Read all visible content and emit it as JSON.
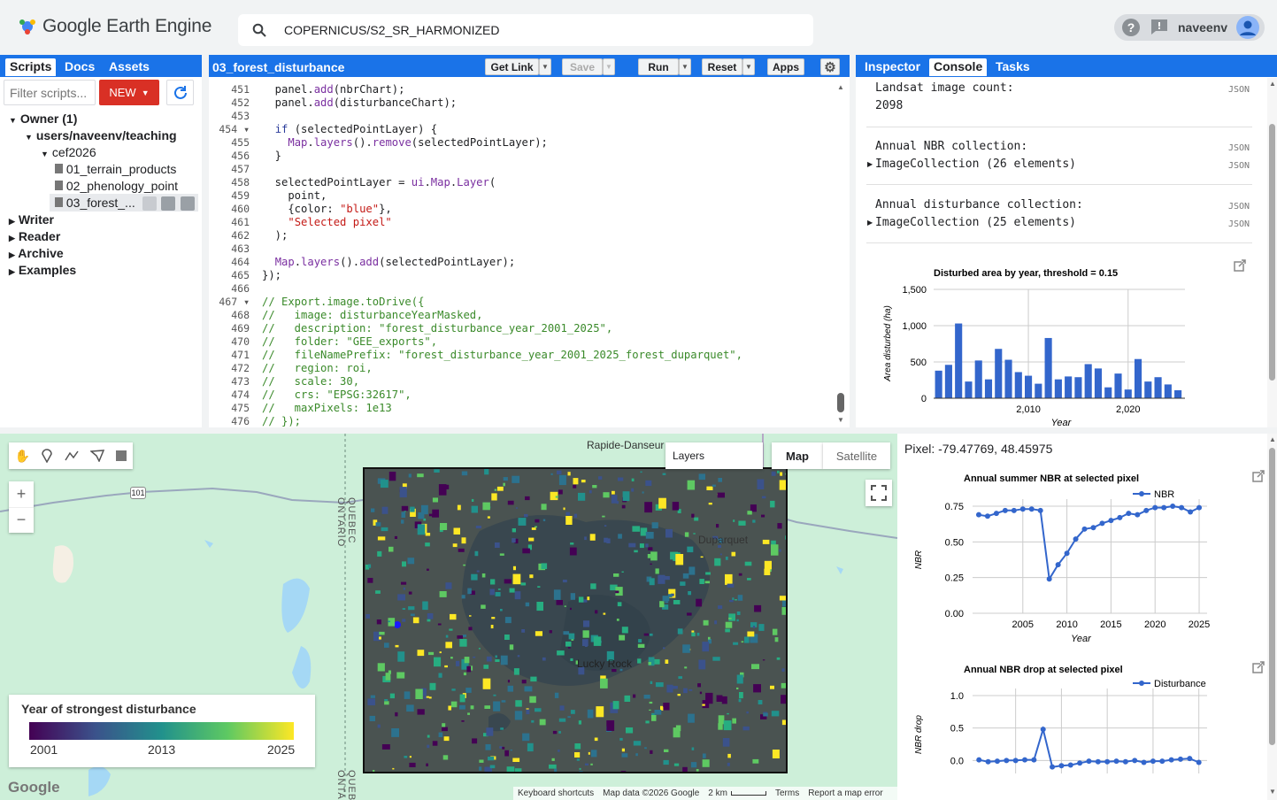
{
  "app": {
    "title": "Google Earth Engine"
  },
  "search": {
    "query": "COPERNICUS/S2_SR_HARMONIZED"
  },
  "user": {
    "name": "naveenv"
  },
  "left_panel": {
    "tabs": [
      "Scripts",
      "Docs",
      "Assets"
    ],
    "filter_placeholder": "Filter scripts...",
    "new_label": "NEW",
    "tree": {
      "owner": "Owner (1)",
      "repo": "users/naveenv/teaching",
      "folder": "cef2026",
      "files": [
        "01_terrain_products",
        "02_phenology_point",
        "03_forest_..."
      ],
      "others": [
        "Writer",
        "Reader",
        "Archive",
        "Examples"
      ]
    }
  },
  "editor": {
    "script_name": "03_forest_disturbance",
    "buttons": {
      "get_link": "Get Link",
      "save": "Save",
      "run": "Run",
      "reset": "Reset",
      "apps": "Apps"
    },
    "lines": [
      {
        "n": "451",
        "html": "  panel.<span class='fn'>add</span>(nbrChart);"
      },
      {
        "n": "452",
        "html": "  panel.<span class='fn'>add</span>(disturbanceChart);"
      },
      {
        "n": "453",
        "html": ""
      },
      {
        "n": "454",
        "html": "  <span class='kw'>if</span> (selectedPointLayer) {"
      },
      {
        "n": "455",
        "html": "    <span class='fn'>Map</span>.<span class='fn'>layers</span>().<span class='fn'>remove</span>(selectedPointLayer);"
      },
      {
        "n": "456",
        "html": "  }"
      },
      {
        "n": "457",
        "html": ""
      },
      {
        "n": "458",
        "html": "  selectedPointLayer = <span class='fn'>ui</span>.<span class='fn'>Map</span>.<span class='fn'>Layer</span>("
      },
      {
        "n": "459",
        "html": "    point,"
      },
      {
        "n": "460",
        "html": "    {color: <span class='st'>\"blue\"</span>},"
      },
      {
        "n": "461",
        "html": "    <span class='st'>\"Selected pixel\"</span>"
      },
      {
        "n": "462",
        "html": "  );"
      },
      {
        "n": "463",
        "html": ""
      },
      {
        "n": "464",
        "html": "  <span class='fn'>Map</span>.<span class='fn'>layers</span>().<span class='fn'>add</span>(selectedPointLayer);"
      },
      {
        "n": "465",
        "html": "});"
      },
      {
        "n": "466",
        "html": ""
      },
      {
        "n": "467",
        "html": "<span class='cm'>// Export.image.toDrive({</span>"
      },
      {
        "n": "468",
        "html": "<span class='cm'>//   image: disturbanceYearMasked,</span>"
      },
      {
        "n": "469",
        "html": "<span class='cm'>//   description: \"forest_disturbance_year_2001_2025\",</span>"
      },
      {
        "n": "470",
        "html": "<span class='cm'>//   folder: \"GEE_exports\",</span>"
      },
      {
        "n": "471",
        "html": "<span class='cm'>//   fileNamePrefix: \"forest_disturbance_year_2001_2025_forest_duparquet\",</span>"
      },
      {
        "n": "472",
        "html": "<span class='cm'>//   region: roi,</span>"
      },
      {
        "n": "473",
        "html": "<span class='cm'>//   scale: 30,</span>"
      },
      {
        "n": "474",
        "html": "<span class='cm'>//   crs: \"EPSG:32617\",</span>"
      },
      {
        "n": "475",
        "html": "<span class='cm'>//   maxPixels: 1e13</span>"
      },
      {
        "n": "476",
        "html": "<span class='cm'>// });</span>"
      }
    ]
  },
  "right_panel": {
    "tabs": [
      "Inspector",
      "Console",
      "Tasks"
    ],
    "console": {
      "landsat_label": "Landsat image count:",
      "landsat_value": "2098",
      "nbr_label": "Annual NBR collection:",
      "nbr_value": "ImageCollection (26 elements)",
      "dist_label": "Annual disturbance collection:",
      "dist_value": "ImageCollection (25 elements)",
      "json": "JSON"
    }
  },
  "map": {
    "layers_label": "Layers",
    "map_type": "Map",
    "satellite_type": "Satellite",
    "places": [
      "Rapide-Danseur",
      "Duparquet",
      "Lucky Rock"
    ],
    "borders": [
      "QUEBEC",
      "ONTARIO"
    ],
    "road": "101",
    "legend": {
      "title": "Year of strongest disturbance",
      "min": "2001",
      "mid": "2013",
      "max": "2025"
    },
    "footer": {
      "shortcuts": "Keyboard shortcuts",
      "data": "Map data ©2026 Google",
      "scale": "2 km",
      "terms": "Terms",
      "report": "Report a map error"
    },
    "google": "Google",
    "zoom_in": "+",
    "zoom_out": "−"
  },
  "pixel_info": {
    "label": "Pixel: -79.47769, 48.45975"
  },
  "chart_data": [
    {
      "type": "bar",
      "title": "Disturbed area by year, threshold = 0.15",
      "xlabel": "Year",
      "ylabel": "Area disturbed (ha)",
      "x": [
        2001,
        2002,
        2003,
        2004,
        2005,
        2006,
        2007,
        2008,
        2009,
        2010,
        2011,
        2012,
        2013,
        2014,
        2015,
        2016,
        2017,
        2018,
        2019,
        2020,
        2021,
        2022,
        2023,
        2024,
        2025
      ],
      "values": [
        380,
        460,
        1030,
        230,
        520,
        260,
        680,
        530,
        360,
        310,
        200,
        830,
        260,
        300,
        290,
        470,
        410,
        150,
        340,
        120,
        540,
        230,
        290,
        190,
        110
      ],
      "ylim": [
        0,
        1500
      ],
      "yticks": [
        "0",
        "500",
        "1,000",
        "1,500"
      ],
      "xticks": [
        {
          "v": 2010,
          "label": "2,010"
        },
        {
          "v": 2020,
          "label": "2,020"
        }
      ],
      "color": "#3366cc"
    },
    {
      "type": "line",
      "title": "Annual summer NBR at selected pixel",
      "xlabel": "Year",
      "ylabel": "NBR",
      "series": [
        {
          "name": "NBR",
          "x": [
            2000,
            2001,
            2002,
            2003,
            2004,
            2005,
            2006,
            2007,
            2008,
            2009,
            2010,
            2011,
            2012,
            2013,
            2014,
            2015,
            2016,
            2017,
            2018,
            2019,
            2020,
            2021,
            2022,
            2023,
            2024,
            2025
          ],
          "values": [
            0.69,
            0.68,
            0.7,
            0.72,
            0.72,
            0.73,
            0.73,
            0.72,
            0.24,
            0.34,
            0.42,
            0.52,
            0.59,
            0.6,
            0.63,
            0.65,
            0.67,
            0.7,
            0.69,
            0.72,
            0.74,
            0.74,
            0.75,
            0.74,
            0.71,
            0.74
          ]
        }
      ],
      "ylim": [
        0,
        0.75
      ],
      "yticks": [
        "0.00",
        "0.25",
        "0.50",
        "0.75"
      ],
      "xticks": [
        "2005",
        "2010",
        "2015",
        "2020",
        "2025"
      ],
      "legend": "top-right",
      "color": "#3366cc"
    },
    {
      "type": "line",
      "title": "Annual NBR drop at selected pixel",
      "xlabel": "",
      "ylabel": "NBR drop",
      "series": [
        {
          "name": "Disturbance",
          "x": [
            2001,
            2002,
            2003,
            2004,
            2005,
            2006,
            2007,
            2008,
            2009,
            2010,
            2011,
            2012,
            2013,
            2014,
            2015,
            2016,
            2017,
            2018,
            2019,
            2020,
            2021,
            2022,
            2023,
            2024,
            2025
          ],
          "values": [
            0.01,
            -0.02,
            -0.01,
            0.0,
            0.0,
            0.01,
            0.01,
            0.48,
            -0.1,
            -0.08,
            -0.07,
            -0.04,
            -0.01,
            -0.02,
            -0.02,
            -0.01,
            -0.02,
            0.0,
            -0.03,
            -0.01,
            -0.01,
            0.01,
            0.02,
            0.03,
            -0.03
          ]
        }
      ],
      "ylim": [
        -0.2,
        1.0
      ],
      "yticks": [
        "0.0",
        "0.5",
        "1.0"
      ],
      "legend": "top-right",
      "color": "#3366cc"
    }
  ]
}
